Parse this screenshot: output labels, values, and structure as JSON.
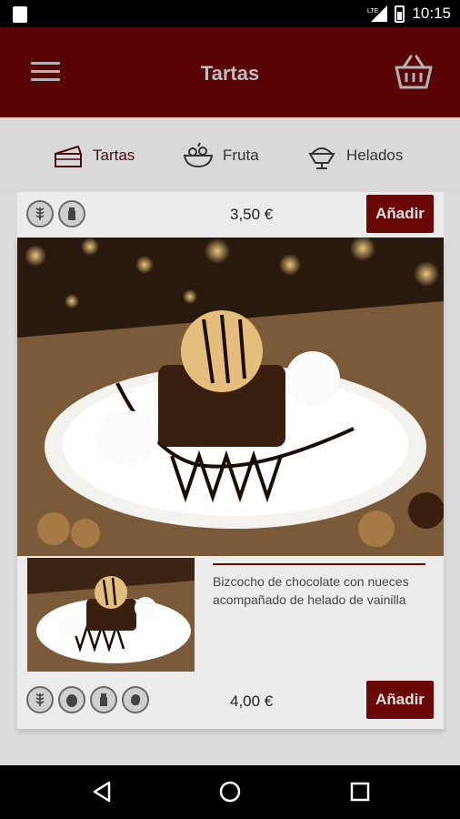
{
  "status_bar": {
    "time": "10:15",
    "network": "LTE",
    "icons": [
      "sd-card-icon",
      "signal-icon",
      "battery-icon"
    ]
  },
  "app_bar": {
    "title": "Tartas",
    "menu_icon": "hamburger-menu-icon",
    "cart_icon": "basket-icon"
  },
  "tabs": [
    {
      "label": "Tartas",
      "icon": "cake-icon",
      "active": true
    },
    {
      "label": "Fruta",
      "icon": "fruit-bowl-icon",
      "active": false
    },
    {
      "label": "Helados",
      "icon": "ice-cream-cup-icon",
      "active": false
    }
  ],
  "products": [
    {
      "price": "3,50 €",
      "add_label": "Añadir",
      "allergens": [
        "gluten-icon",
        "milk-icon"
      ]
    },
    {
      "description": "Bizcocho de chocolate con nueces acompañado de helado de vainilla",
      "price": "4,00 €",
      "add_label": "Añadir",
      "allergens": [
        "gluten-icon",
        "egg-icon",
        "milk-icon",
        "nuts-icon"
      ]
    }
  ],
  "colors": {
    "app_bar": "#5a0505",
    "accent": "#6a0707",
    "tab_bar": "#d9d9d9",
    "card": "#ececec"
  },
  "nav_bar": {
    "icons": [
      "back-icon",
      "home-icon",
      "recents-icon"
    ]
  }
}
